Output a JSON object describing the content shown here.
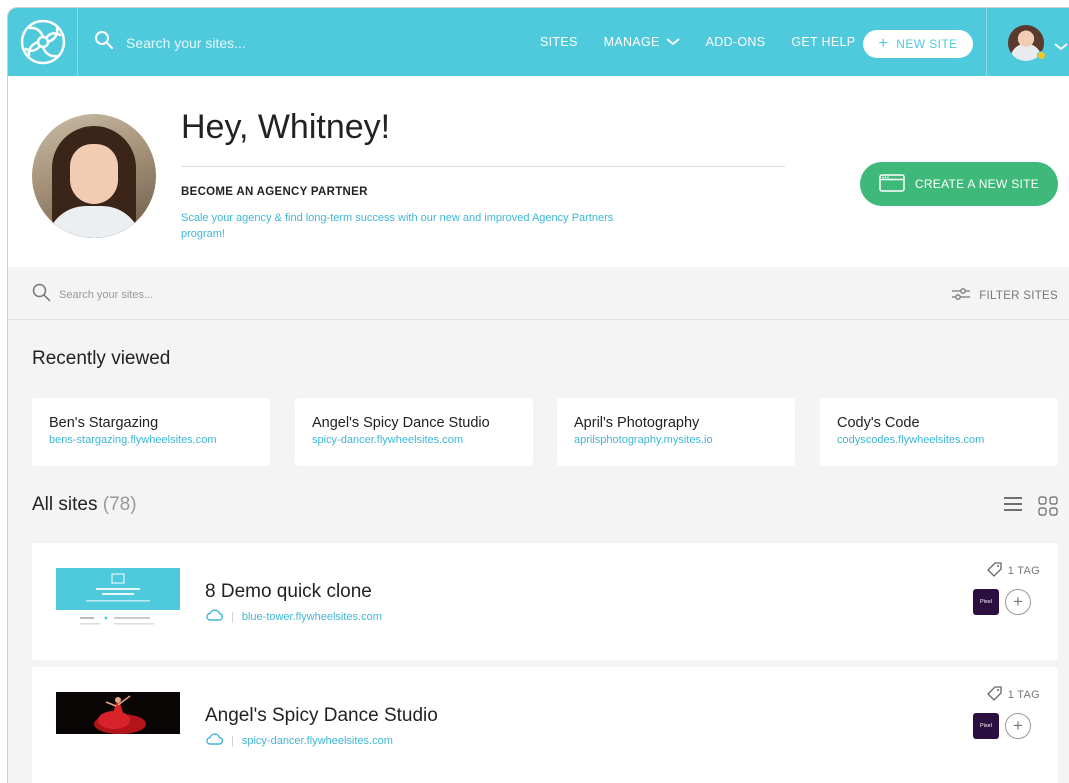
{
  "topnav": {
    "search_placeholder": "Search your sites...",
    "links": [
      {
        "label": "SITES"
      },
      {
        "label": "MANAGE"
      },
      {
        "label": "ADD-ONS"
      },
      {
        "label": "GET HELP"
      }
    ],
    "new_site_label": "NEW SITE",
    "new_site_icon": "+",
    "accent_color": "#4fc9dc"
  },
  "header": {
    "greeting": "Hey, Whitney!",
    "partner_title": "BECOME AN AGENCY PARTNER",
    "partner_text": "Scale your agency & find long-term success with our new and improved Agency Partners program!",
    "create_button_label": "CREATE A NEW SITE",
    "create_button_color": "#3fb97a"
  },
  "filterbar": {
    "search_placeholder": "Search your sites...",
    "filter_label": "FILTER SITES"
  },
  "recent": {
    "title": "Recently viewed",
    "items": [
      {
        "name": "Ben's Stargazing",
        "url": "bens-stargazing.flywheelsites.com"
      },
      {
        "name": "Angel's Spicy Dance Studio",
        "url": "spicy-dancer.flywheelsites.com"
      },
      {
        "name": "April's Photography",
        "url": "aprilsphotography.mysites.io"
      },
      {
        "name": "Cody's Code",
        "url": "codyscodes.flywheelsites.com"
      }
    ]
  },
  "all_sites": {
    "title": "All sites",
    "count": "(78)",
    "sites": [
      {
        "name": "8 Demo quick clone",
        "url": "blue-tower.flywheelsites.com",
        "tags": "1 TAG",
        "badge": "Pixel"
      },
      {
        "name": "Angel's Spicy Dance Studio",
        "url": "spicy-dancer.flywheelsites.com",
        "tags": "1 TAG",
        "badge": "Pixel"
      }
    ]
  },
  "icons": [
    "flywheel-logo-icon",
    "search-icon",
    "chevron-down-icon",
    "plus-icon",
    "browser-window-icon",
    "filter-sliders-icon",
    "list-view-icon",
    "grid-view-icon",
    "cloud-icon",
    "tag-icon",
    "add-circle-icon"
  ]
}
